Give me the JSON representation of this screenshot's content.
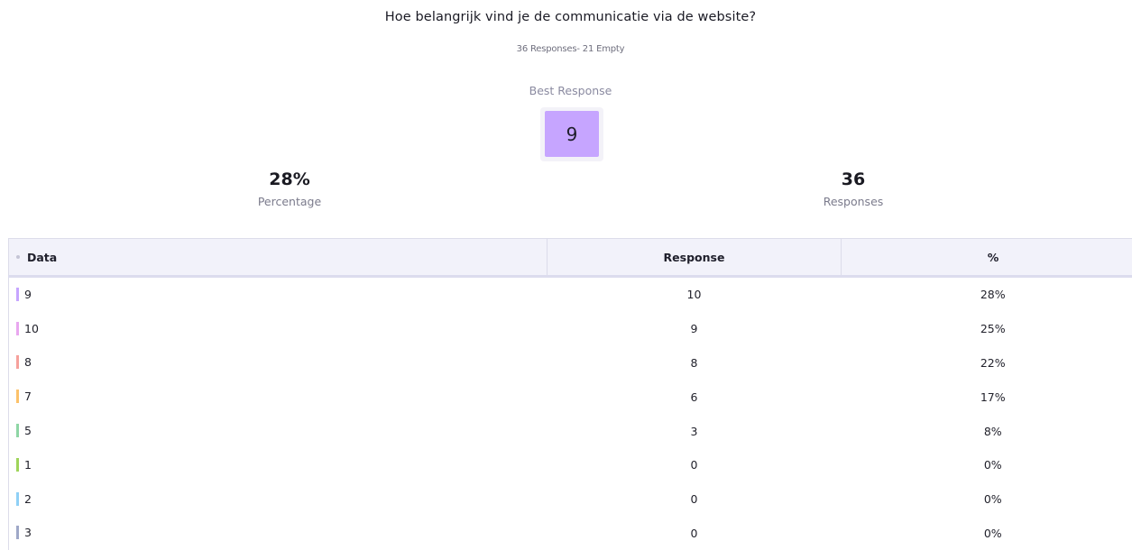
{
  "question": {
    "title": "Hoe belangrijk vind je de communicatie via de website?",
    "summary": "36 Responses- 21 Empty"
  },
  "best_response": {
    "label": "Best Response",
    "value": "9",
    "color": "#c6a5ff"
  },
  "stats": {
    "percentage_value": "28%",
    "percentage_label": "Percentage",
    "responses_value": "36",
    "responses_label": "Responses"
  },
  "table": {
    "headers": {
      "data": "Data",
      "response": "Response",
      "percent": "%"
    },
    "rows": [
      {
        "data": "9",
        "response": "10",
        "percent": "28%",
        "color": "#c6a5ff"
      },
      {
        "data": "10",
        "response": "9",
        "percent": "25%",
        "color": "#e9a7ef"
      },
      {
        "data": "8",
        "response": "8",
        "percent": "22%",
        "color": "#f6a19c"
      },
      {
        "data": "7",
        "response": "6",
        "percent": "17%",
        "color": "#fcc26a"
      },
      {
        "data": "5",
        "response": "3",
        "percent": "8%",
        "color": "#8ed6a5"
      },
      {
        "data": "1",
        "response": "0",
        "percent": "0%",
        "color": "#9fd45a"
      },
      {
        "data": "2",
        "response": "0",
        "percent": "0%",
        "color": "#8fd0f6"
      },
      {
        "data": "3",
        "response": "0",
        "percent": "0%",
        "color": "#9fa8c8"
      }
    ]
  }
}
